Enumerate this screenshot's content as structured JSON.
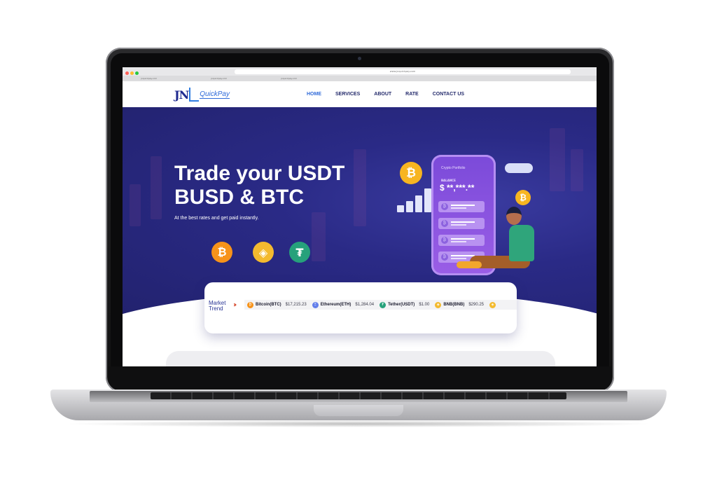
{
  "browser": {
    "url": "www.jnquickpay.com",
    "tabs": [
      "jnquickpay.com",
      "jnquickpay.com",
      "jnquickpay.com"
    ]
  },
  "site": {
    "logo_letters": "JN",
    "logo_text": "QuickPay",
    "nav": [
      {
        "label": "HOME",
        "active": true
      },
      {
        "label": "SERVICES",
        "active": false
      },
      {
        "label": "ABOUT",
        "active": false
      },
      {
        "label": "RATE",
        "active": false
      },
      {
        "label": "CONTACT US",
        "active": false
      }
    ]
  },
  "hero": {
    "title_line1": "Trade your USDT",
    "title_line2": "BUSD & BTC",
    "subtitle": "At the best rates and get paid instantly.",
    "coins": [
      {
        "icon": "bitcoin-icon",
        "glyph": "₿",
        "color": "#f7931a"
      },
      {
        "icon": "binance-icon",
        "glyph": "◈",
        "color": "#f3ba2f"
      },
      {
        "icon": "tether-icon",
        "glyph": "₮",
        "color": "#26a17b"
      }
    ]
  },
  "illustration": {
    "wallet_title": "Crypto Portfolio",
    "balance_label": "BALANCE",
    "balance_value": "$ **,***.**"
  },
  "market": {
    "label_line1": "Market",
    "label_line2": "Trend",
    "tickers": [
      {
        "name": "Bitcoin(BTC)",
        "price": "$17,215.23",
        "color": "#f7931a",
        "glyph": "₿"
      },
      {
        "name": "Ethereum(ETH)",
        "price": "$1,284.04",
        "color": "#627eea",
        "glyph": "Ξ"
      },
      {
        "name": "Tether(USDT)",
        "price": "$1.00",
        "color": "#26a17b",
        "glyph": "₮"
      },
      {
        "name": "BNB(BNB)",
        "price": "$290.25",
        "color": "#f3ba2f",
        "glyph": "◈"
      }
    ]
  },
  "colors": {
    "hero_bg": "#2a2a86",
    "nav_text": "#232a6b",
    "accent": "#2f6ad9"
  }
}
